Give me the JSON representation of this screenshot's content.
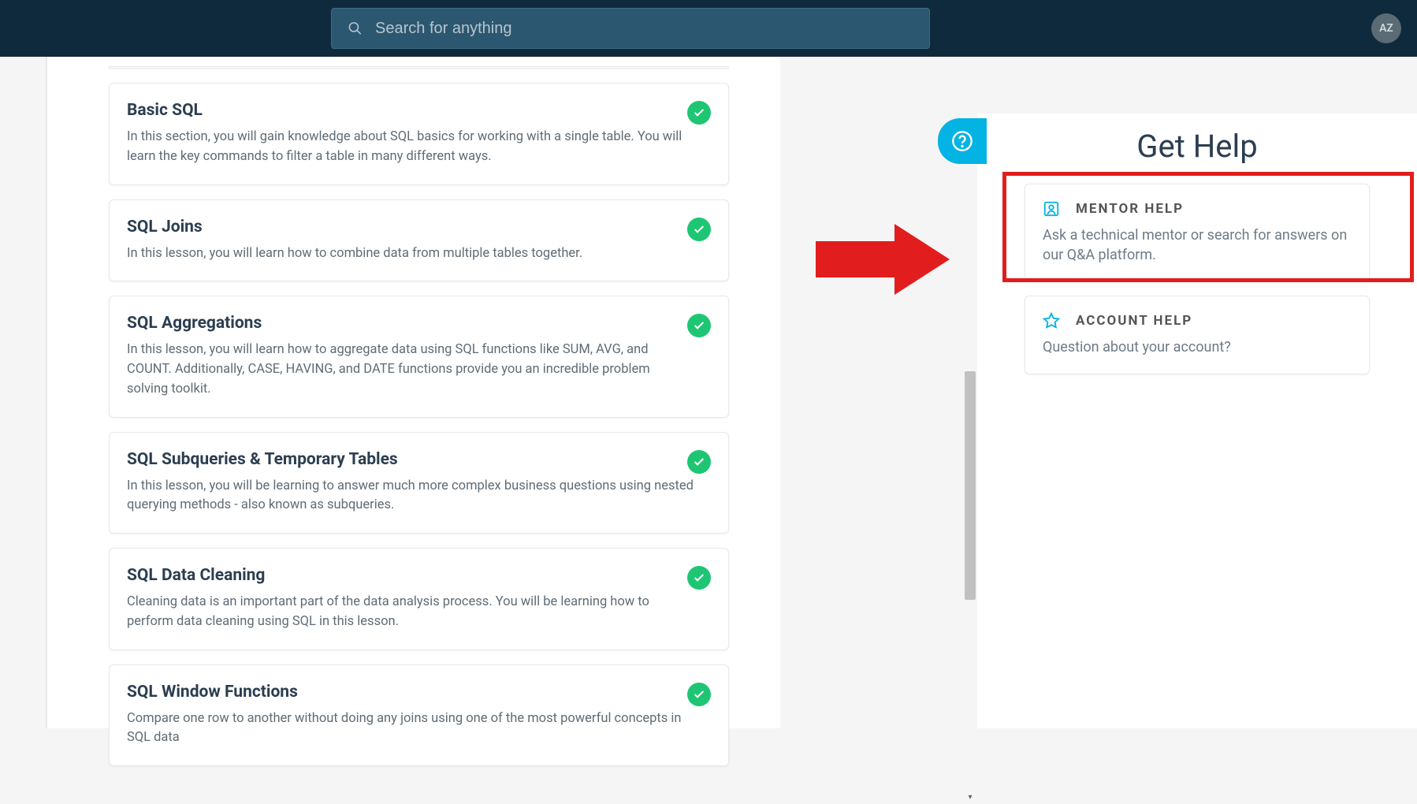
{
  "header": {
    "search_placeholder": "Search for anything",
    "avatar_initials": "AZ"
  },
  "lessons": [
    {
      "title": "Basic SQL",
      "desc": "In this section, you will gain knowledge about SQL basics for working with a single table. You will learn the key commands to filter a table in many different ways.",
      "completed": true
    },
    {
      "title": "SQL Joins",
      "desc": "In this lesson, you will learn how to combine data from multiple tables together.",
      "completed": true
    },
    {
      "title": "SQL Aggregations",
      "desc": "In this lesson, you will learn how to aggregate data using SQL functions like SUM, AVG, and COUNT. Additionally, CASE, HAVING, and DATE functions provide you an incredible problem solving toolkit.",
      "completed": true
    },
    {
      "title": "SQL Subqueries & Temporary Tables",
      "desc": "In this lesson, you will be learning to answer much more complex business questions using nested querying methods - also known as subqueries.",
      "completed": true
    },
    {
      "title": "SQL Data Cleaning",
      "desc": "Cleaning data is an important part of the data analysis process. You will be learning how to perform data cleaning using SQL in this lesson.",
      "completed": true
    },
    {
      "title": "SQL Window Functions",
      "desc": "Compare one row to another without doing any joins using one of the most powerful concepts in SQL data",
      "completed": true
    }
  ],
  "help_panel": {
    "title": "Get Help",
    "cards": [
      {
        "title": "MENTOR HELP",
        "desc": "Ask a technical mentor or search for answers on our Q&A platform."
      },
      {
        "title": "ACCOUNT HELP",
        "desc": "Question about your account?"
      }
    ]
  }
}
